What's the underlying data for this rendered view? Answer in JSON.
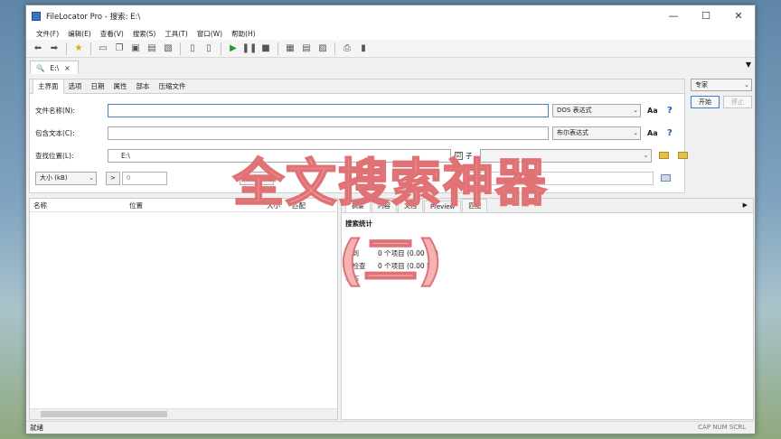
{
  "window": {
    "title": "FileLocator Pro - 搜索: E:\\",
    "min": "—",
    "max": "☐",
    "close": "✕"
  },
  "menu": [
    "文件(F)",
    "编辑(E)",
    "查看(V)",
    "搜索(S)",
    "工具(T)",
    "窗口(W)",
    "帮助(H)"
  ],
  "search_tab": {
    "label": "E:\\",
    "close": "×"
  },
  "criteria": {
    "tabs": [
      "主界面",
      "选项",
      "日期",
      "属性",
      "部本",
      "压缩文件"
    ],
    "file_name_label": "文件名称(N):",
    "file_name_value": "",
    "file_name_mode": "DOS 表达式",
    "contains_label": "包含文本(C):",
    "contains_value": "",
    "contains_mode": "布尔表达式",
    "look_in_label": "查找位置(L):",
    "look_in_value": "E:\\",
    "subfolders_check": "☑",
    "subfolders_label": "子",
    "size_select": "大小 (kB)",
    "size_op": ">",
    "size_value": "0",
    "modified_label": "修改日期",
    "aa": "Aa",
    "help": "?"
  },
  "side": {
    "mode": "专家",
    "start": "开始",
    "stop": "停止"
  },
  "results": {
    "columns": [
      "名称",
      "位置",
      "大小",
      "匹配"
    ]
  },
  "stats": {
    "tabs": [
      "摘要",
      "内容",
      "文档",
      "Preview",
      "匹配"
    ],
    "title": "搜索统计",
    "found_label": "找到",
    "found_value": "0 个项目 (0.00 KB)",
    "checked_label": "已检查",
    "checked_value": "0 个项目 (0.00 KB)",
    "status_label": "状态",
    "status_value": ""
  },
  "statusbar": {
    "text": "就绪",
    "keys": "CAP  NUM  SCRL"
  },
  "overlay": {
    "title": "全文搜索神器",
    "subtitle": "(二)"
  }
}
